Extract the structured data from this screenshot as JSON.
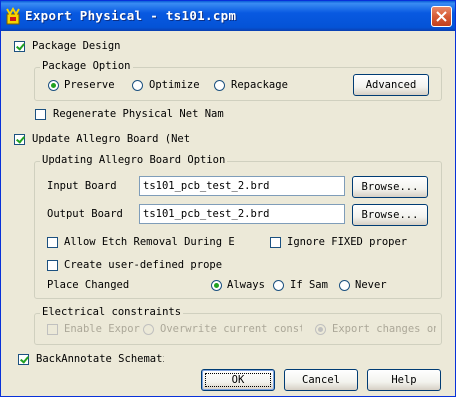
{
  "window": {
    "title": "Export Physical - ts101.cpm"
  },
  "package_design": {
    "label": "Package Design",
    "checked": true,
    "option_group": {
      "legend": "Package Option",
      "options": [
        {
          "label": "Preserve",
          "selected": true
        },
        {
          "label": "Optimize",
          "selected": false
        },
        {
          "label": "Repackage",
          "selected": false
        }
      ],
      "advanced_label": "Advanced"
    },
    "regenerate_label": "Regenerate Physical Net Nam",
    "regenerate_checked": false
  },
  "update_board": {
    "label": "Update Allegro Board (Net",
    "checked": true,
    "option_group": {
      "legend": "Updating Allegro Board Option",
      "input_label": "Input Board",
      "input_value": "ts101_pcb_test_2.brd",
      "input_browse": "Browse...",
      "output_label": "Output Board",
      "output_value": "ts101_pcb_test_2.brd",
      "output_browse": "Browse...",
      "allow_etch_label": "Allow Etch Removal During E",
      "allow_etch_checked": false,
      "ignore_fixed_label": "Ignore FIXED proper",
      "ignore_fixed_checked": false,
      "user_defined_label": "Create user-defined prope",
      "user_defined_checked": false,
      "place_changed_label": "Place Changed",
      "place_changed_options": [
        {
          "label": "Always",
          "selected": true
        },
        {
          "label": "If Sam",
          "selected": false
        },
        {
          "label": "Never",
          "selected": false
        }
      ]
    }
  },
  "electrical": {
    "legend": "Electrical constraints",
    "enable_label": "Enable Expor",
    "enable_checked": false,
    "overwrite_label": "Overwrite current constr",
    "export_changes_label": "Export changes on"
  },
  "backannotate": {
    "label": "BackAnnotate Schemati",
    "checked": true
  },
  "buttons": {
    "ok": "OK",
    "cancel": "Cancel",
    "help": "Help"
  }
}
